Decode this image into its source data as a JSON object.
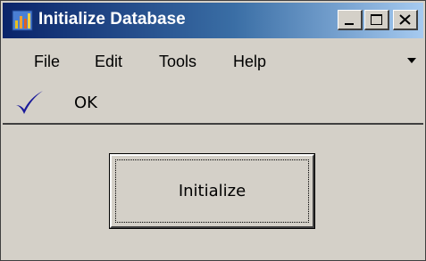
{
  "window": {
    "title": "Initialize Database",
    "title_color": "#0a246a",
    "buttons": [
      "minimize-icon",
      "maximize-icon",
      "close-icon"
    ]
  },
  "menu": {
    "items": [
      {
        "label": "File"
      },
      {
        "label": "Edit"
      },
      {
        "label": "Tools"
      },
      {
        "label": "Help"
      }
    ],
    "overflow_icon": "chevron-down-icon"
  },
  "status": {
    "icon": "checkmark-icon",
    "icon_color": "#1a1a9a",
    "text": "OK"
  },
  "main": {
    "initialize_label": "Initialize"
  }
}
